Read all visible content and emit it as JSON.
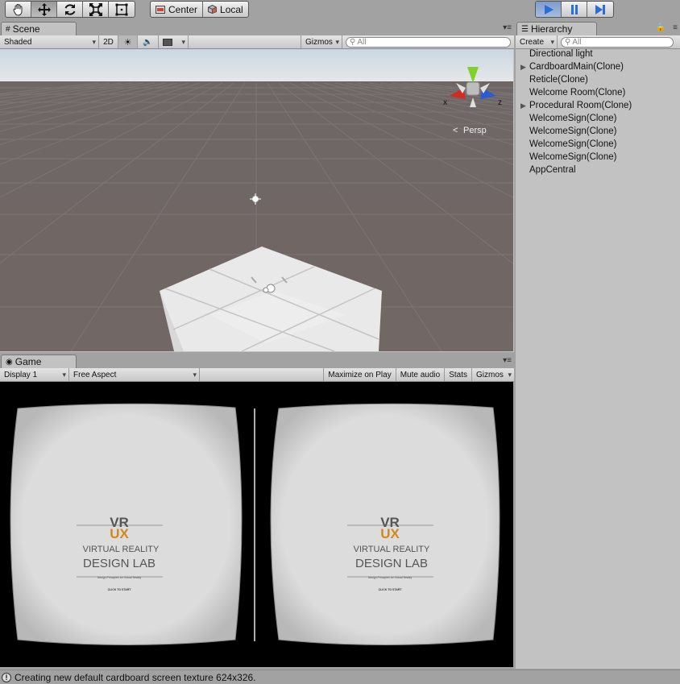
{
  "toolbar": {
    "transform_tools": [
      {
        "name": "hand-tool-button",
        "icon": "hand-icon",
        "active": false
      },
      {
        "name": "move-tool-button",
        "icon": "move-arrows-icon",
        "active": true
      },
      {
        "name": "rotate-tool-button",
        "icon": "rotate-icon",
        "active": false
      },
      {
        "name": "scale-tool-button",
        "icon": "scale-icon",
        "active": false
      },
      {
        "name": "rect-tool-button",
        "icon": "rect-transform-icon",
        "active": false
      }
    ],
    "pivot_label": "Center",
    "space_label": "Local",
    "play_icon": "play-icon",
    "pause_icon": "pause-icon",
    "step_icon": "step-icon",
    "play_active_color": "#2a6fd6"
  },
  "scene": {
    "tab_label": "Scene",
    "shading_mode": "Shaded",
    "mode_2d_label": "2D",
    "gizmos_label": "Gizmos",
    "search_placeholder": "All",
    "projection_label": "Persp",
    "axis_x_label": "x",
    "axis_z_label": "z",
    "axis_colors": {
      "x": "#d22b22",
      "y": "#7fd22b",
      "z": "#2b5bd2"
    }
  },
  "game": {
    "tab_label": "Game",
    "display_label": "Display 1",
    "aspect_label": "Free Aspect",
    "maximize_label": "Maximize on Play",
    "mute_label": "Mute audio",
    "stats_label": "Stats",
    "gizmos_label": "Gizmos",
    "logo_vr": "VR",
    "logo_ux": "UX",
    "logo_line1": "VIRTUAL REALITY",
    "logo_line2": "DESIGN LAB",
    "logo_tagline": "Design Principles for Virtual Reality",
    "start_label": "CLICK TO START",
    "logo_accent_color": "#d4861e"
  },
  "hierarchy": {
    "tab_label": "Hierarchy",
    "create_label": "Create",
    "search_placeholder": "All",
    "items": [
      {
        "label": "Directional light",
        "expandable": false
      },
      {
        "label": "CardboardMain(Clone)",
        "expandable": true
      },
      {
        "label": "Reticle(Clone)",
        "expandable": false
      },
      {
        "label": "Welcome Room(Clone)",
        "expandable": false
      },
      {
        "label": "Procedural Room(Clone)",
        "expandable": true
      },
      {
        "label": "WelcomeSign(Clone)",
        "expandable": false
      },
      {
        "label": "WelcomeSign(Clone)",
        "expandable": false
      },
      {
        "label": "WelcomeSign(Clone)",
        "expandable": false
      },
      {
        "label": "WelcomeSign(Clone)",
        "expandable": false
      },
      {
        "label": "AppCentral",
        "expandable": false
      }
    ]
  },
  "status": {
    "message": "Creating new default cardboard screen texture 624x326."
  }
}
